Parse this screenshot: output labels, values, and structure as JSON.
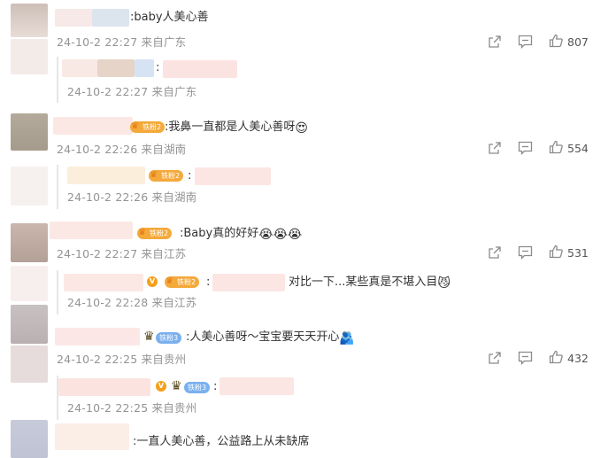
{
  "comments": [
    {
      "text": ":baby人美心善",
      "meta": "24-10-2 22:27 来自广东",
      "likes": "807",
      "reply": {
        "text": ":",
        "meta": "24-10-2 22:27 来自广东"
      }
    },
    {
      "badge": "铁粉2",
      "text": ":我鼻一直都是人美心善呀",
      "emoji": "😍",
      "meta": "24-10-2 22:26 来自湖南",
      "likes": "554",
      "reply": {
        "badge": "铁粉2",
        "text": ":",
        "meta": "24-10-2 22:26 来自湖南"
      }
    },
    {
      "badge": "铁粉2",
      "text": ":Baby真的好好",
      "emoji": "😭😭😭",
      "meta": "24-10-2 22:27 来自江苏",
      "likes": "531",
      "reply": {
        "badge": "铁粉2",
        "text": ":",
        "text2": "对比一下...某些真是不堪入目",
        "emoji": "😼",
        "meta": "24-10-2 22:28 来自江苏"
      }
    },
    {
      "badge": "铁粉3",
      "text": ":人美心善呀～宝宝要天天开心",
      "emoji": "🫂",
      "meta": "24-10-2 22:25 来自贵州",
      "likes": "432",
      "reply": {
        "badge": "铁粉3",
        "text": ":",
        "meta": "24-10-2 22:25 来自贵州"
      }
    },
    {
      "text": ":一直人美心善，公益路上从未缺席"
    }
  ],
  "icons": {
    "share": "share-icon",
    "comment": "comment-icon",
    "like": "thumbs-up-icon",
    "vip": "verified-v-icon",
    "crown": "crown-icon"
  },
  "colors": {
    "meta_gray": "#939393",
    "badge_orange": "#f4a93a",
    "badge_blue": "#7ab0ee",
    "vip_orange": "#f59f1a"
  }
}
